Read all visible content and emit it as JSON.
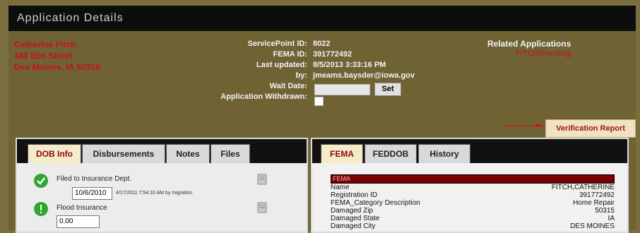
{
  "window": {
    "title": "Application Details"
  },
  "applicant": {
    "name": "Catherine Fitch",
    "street": "488 Elm Street",
    "city": "Des Moines, IA 50315"
  },
  "meta": {
    "servicepoint_label": "ServicePoint ID:",
    "servicepoint_value": "8022",
    "fema_label": "FEMA ID:",
    "fema_value": "391772492",
    "updated_label": "Last updated:",
    "updated_value": "8/5/2013 3:33:16 PM",
    "by_label": "by:",
    "by_value": "jmeams.baysder@iowa.gov",
    "wait_label": "Wait Date:",
    "wait_value": "",
    "set_label": "Set",
    "withdrawn_label": "Application Withdrawn:"
  },
  "related": {
    "title": "Related Applications",
    "link": "FITCH[Pending]"
  },
  "verification": {
    "label": "Verification Report"
  },
  "left_tabs": [
    {
      "label": "DOB Info",
      "active": true
    },
    {
      "label": "Disbursements",
      "active": false
    },
    {
      "label": "Notes",
      "active": false
    },
    {
      "label": "Files",
      "active": false
    }
  ],
  "left_items": [
    {
      "label": "Filed to Insurance Dept.",
      "date": "10/6/2010",
      "note": "4/17/2011 7:54:10 AM by migration",
      "status": "green"
    },
    {
      "label": "Flood Insurance",
      "value": "0.00",
      "status": "green-exclaim"
    }
  ],
  "right_tabs": [
    {
      "label": "FEMA",
      "active": true
    },
    {
      "label": "FEDDOB",
      "active": false
    },
    {
      "label": "History",
      "active": false
    }
  ],
  "fema": {
    "header": "FEMA",
    "rows": [
      {
        "key": "Name",
        "value": "FITCH,CATHERINE"
      },
      {
        "key": "Registration ID",
        "value": "391772492"
      },
      {
        "key": "FEMA_Category Description",
        "value": "Home Repair"
      },
      {
        "key": "Damaged Zip",
        "value": "50315"
      },
      {
        "key": "Damaged State",
        "value": "IA"
      },
      {
        "key": "Damaged City",
        "value": "DES MOINES"
      }
    ]
  },
  "colors": {
    "accent_red": "#c8101a",
    "panel": "#6f6334",
    "titlebar": "#0d0d0d"
  }
}
